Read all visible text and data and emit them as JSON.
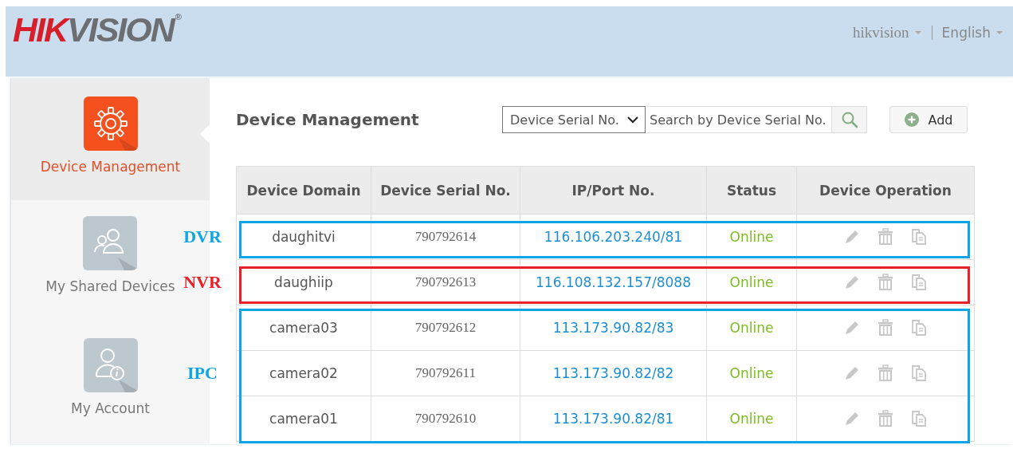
{
  "header": {
    "logo": {
      "prefix": "HIK",
      "suffix": "VISION",
      "mark": "®"
    },
    "user_menu": "hikvision",
    "language_menu": "English"
  },
  "sidebar": {
    "items": [
      {
        "label": "Device Management",
        "selected": true
      },
      {
        "label": "My Shared Devices",
        "selected": false
      },
      {
        "label": "My Account",
        "selected": false
      }
    ]
  },
  "page_title": "Device Management",
  "search": {
    "filter": "Device Serial No.",
    "placeholder": "Search by Device Serial No."
  },
  "add_button": "Add",
  "table": {
    "columns": [
      "Device Domain",
      "Device Serial No.",
      "IP/Port No.",
      "Status",
      "Device Operation"
    ],
    "row_groups": [
      {
        "label": "DVR",
        "color": "#0ea5e6",
        "rows": [
          {
            "domain": "daughitvi",
            "serial": "790792614",
            "ip": "116.106.203.240/81",
            "status": "Online"
          }
        ]
      },
      {
        "label": "NVR",
        "color": "#e8202a",
        "rows": [
          {
            "domain": "daughiip",
            "serial": "790792613",
            "ip": "116.108.132.157/8088",
            "status": "Online"
          }
        ]
      },
      {
        "label": "IPC",
        "color": "#0ea5e6",
        "rows": [
          {
            "domain": "camera03",
            "serial": "790792612",
            "ip": "113.173.90.82/83",
            "status": "Online"
          },
          {
            "domain": "camera02",
            "serial": "790792611",
            "ip": "113.173.90.82/82",
            "status": "Online"
          },
          {
            "domain": "camera01",
            "serial": "790792610",
            "ip": "113.173.90.82/81",
            "status": "Online"
          }
        ]
      }
    ]
  }
}
